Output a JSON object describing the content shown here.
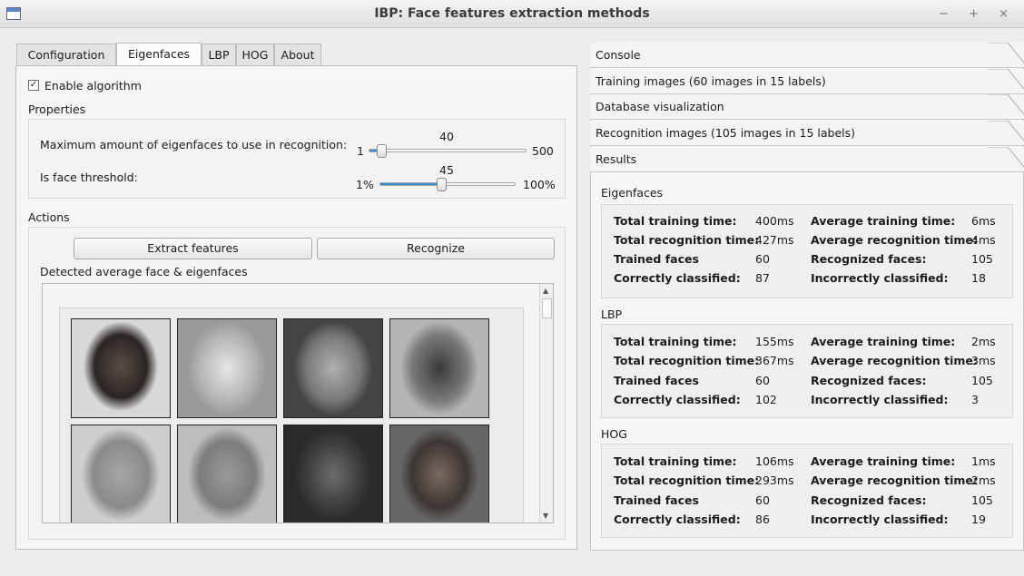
{
  "window": {
    "title": "IBP: Face features extraction methods",
    "controls": "− + ×"
  },
  "tabs": [
    "Configuration",
    "Eigenfaces",
    "LBP",
    "HOG",
    "About"
  ],
  "eigenfaces": {
    "enable_label": "Enable algorithm",
    "enable_checked": true,
    "check_mark": "✓",
    "properties_label": "Properties",
    "max_eigenfaces_label": "Maximum amount of eigenfaces to use in recognition:",
    "max_min": "1",
    "max_max": "500",
    "max_value": "40",
    "max_fraction": 0.078,
    "threshold_label": "Is face threshold:",
    "thr_min": "1%",
    "thr_max": "100%",
    "thr_value": "45",
    "thr_fraction": 0.45,
    "actions_label": "Actions",
    "extract_button": "Extract features",
    "recognize_button": "Recognize",
    "detected_label": "Detected average face & eigenfaces"
  },
  "toolbox": [
    "Console",
    "Training images (60 images in 15 labels)",
    "Database visualization",
    "Recognition images (105 images in 15 labels)",
    "Results"
  ],
  "results": [
    {
      "name": "Eigenfaces",
      "rows": [
        [
          "Total training time:",
          "400ms",
          "Average training time:",
          "6ms"
        ],
        [
          "Total recognition time:",
          "427ms",
          "Average recognition time:",
          "4ms"
        ],
        [
          "Trained faces",
          "60",
          "Recognized faces:",
          "105"
        ],
        [
          "Correctly classified:",
          "87",
          "Incorrectly classified:",
          "18"
        ]
      ]
    },
    {
      "name": "LBP",
      "rows": [
        [
          "Total training time:",
          "155ms",
          "Average training time:",
          "2ms"
        ],
        [
          "Total recognition time:",
          "367ms",
          "Average recognition time:",
          "3ms"
        ],
        [
          "Trained faces",
          "60",
          "Recognized faces:",
          "105"
        ],
        [
          "Correctly classified:",
          "102",
          "Incorrectly classified:",
          "3"
        ]
      ]
    },
    {
      "name": "HOG",
      "rows": [
        [
          "Total training time:",
          "106ms",
          "Average training time:",
          "1ms"
        ],
        [
          "Total recognition time:",
          "293ms",
          "Average recognition time:",
          "2ms"
        ],
        [
          "Trained faces",
          "60",
          "Recognized faces:",
          "105"
        ],
        [
          "Correctly classified:",
          "86",
          "Incorrectly classified:",
          "19"
        ]
      ]
    }
  ],
  "face_images": [
    "average-face",
    "eigenface-1",
    "eigenface-2",
    "eigenface-3",
    "eigenface-4",
    "eigenface-5",
    "eigenface-6",
    "eigenface-7"
  ]
}
